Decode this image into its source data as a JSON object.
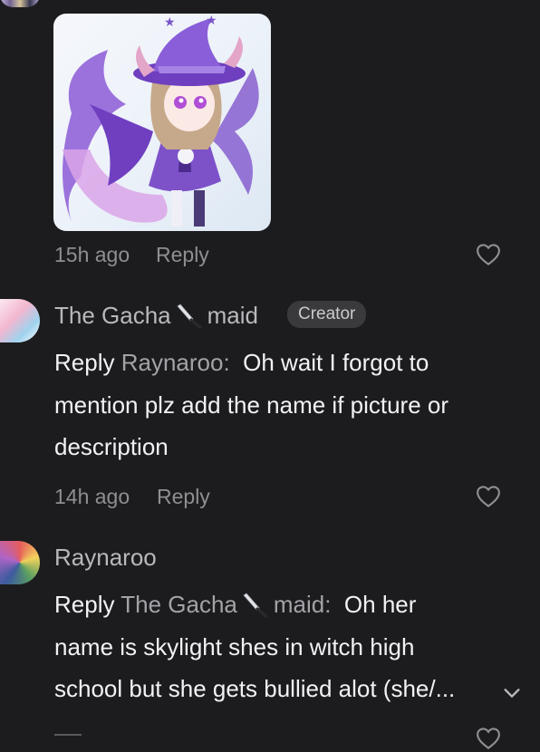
{
  "previous_comment": {
    "time": "15h ago",
    "reply_label": "Reply"
  },
  "comment1": {
    "author_prefix": "The Gacha",
    "author_suffix": "maid",
    "badge": "Creator",
    "reply_prefix": "Reply",
    "reply_to": "Raynaroo:",
    "text_line1": "Oh wait I forgot to",
    "text_line2": "mention plz add the name if picture or",
    "text_line3": "description",
    "time": "14h ago",
    "reply_label": "Reply"
  },
  "comment2": {
    "author": "Raynaroo",
    "reply_prefix": "Reply",
    "reply_to_prefix": "The Gacha",
    "reply_to_suffix": "maid:",
    "text_line1": "Oh her",
    "text_line2": "name is skylight shes in witch high",
    "text_line3": "school but she gets bullied alot (she/..."
  },
  "colors": {
    "background": "#1c1c1e",
    "muted": "#8e8e93",
    "text": "#f2f2f5"
  },
  "icons": [
    "heart-outline-icon",
    "knife-emoji-icon",
    "chevron-down-icon"
  ]
}
